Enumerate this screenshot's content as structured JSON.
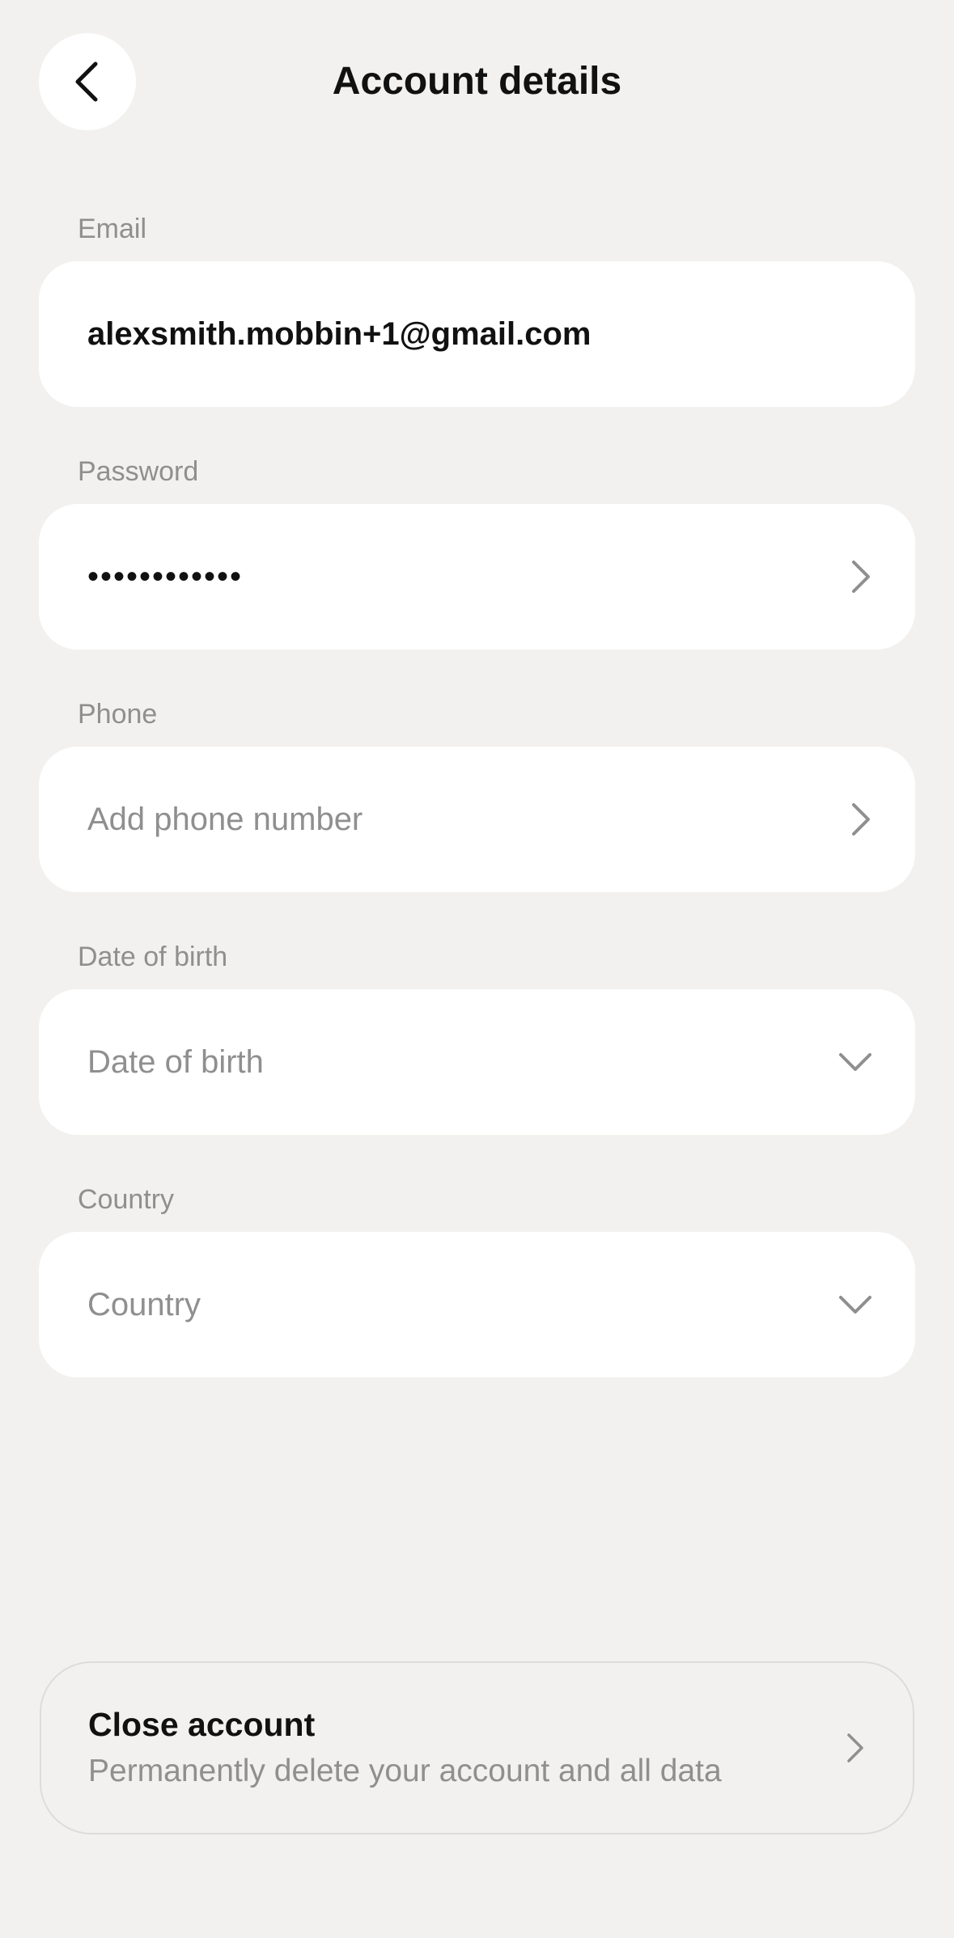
{
  "header": {
    "title": "Account details",
    "back_icon": "chevron-left-icon"
  },
  "fields": {
    "email": {
      "label": "Email",
      "value": "alexsmith.mobbin+1@gmail.com"
    },
    "password": {
      "label": "Password",
      "value": "••••••••••••",
      "icon": "chevron-right-icon"
    },
    "phone": {
      "label": "Phone",
      "placeholder": "Add phone number",
      "icon": "chevron-right-icon"
    },
    "dob": {
      "label": "Date of birth",
      "placeholder": "Date of birth",
      "icon": "chevron-down-icon"
    },
    "country": {
      "label": "Country",
      "placeholder": "Country",
      "icon": "chevron-down-icon"
    }
  },
  "close_account": {
    "title": "Close account",
    "subtitle": "Permanently delete your account and all data",
    "icon": "chevron-right-icon"
  },
  "colors": {
    "background": "#f2f1ef",
    "field_background": "#ffffff",
    "text_primary": "#111111",
    "text_secondary": "#8f8f8f"
  }
}
